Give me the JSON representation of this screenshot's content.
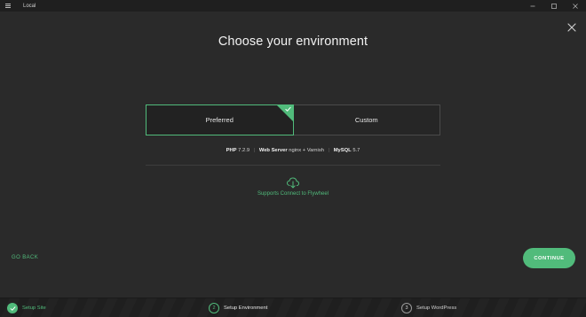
{
  "window": {
    "title": "Local",
    "menu_icon": "hamburger-icon",
    "controls": [
      "minimize-icon",
      "maximize-icon",
      "close-icon"
    ]
  },
  "page": {
    "heading": "Choose your environment",
    "close_icon": "close-icon"
  },
  "environment": {
    "options": [
      {
        "label": "Preferred",
        "selected": true
      },
      {
        "label": "Custom",
        "selected": false
      }
    ]
  },
  "specs": {
    "php_label": "PHP",
    "php_value": "7.2.9",
    "web_label": "Web Server",
    "web_value": "nginx + Varnish",
    "mysql_label": "MySQL",
    "mysql_value": "5.7"
  },
  "connect": {
    "icon": "cloud-download-icon",
    "text": "Supports Connect to Flywheel"
  },
  "actions": {
    "go_back": "GO BACK",
    "continue": "CONTINUE"
  },
  "steps": [
    {
      "number": "1",
      "label": "Setup Site",
      "state": "done"
    },
    {
      "number": "2",
      "label": "Setup Environment",
      "state": "active"
    },
    {
      "number": "3",
      "label": "Setup WordPress",
      "state": "pending"
    }
  ],
  "colors": {
    "accent": "#51bb7b",
    "background": "#2a2a2a",
    "titlebar": "#1f1f1f"
  }
}
